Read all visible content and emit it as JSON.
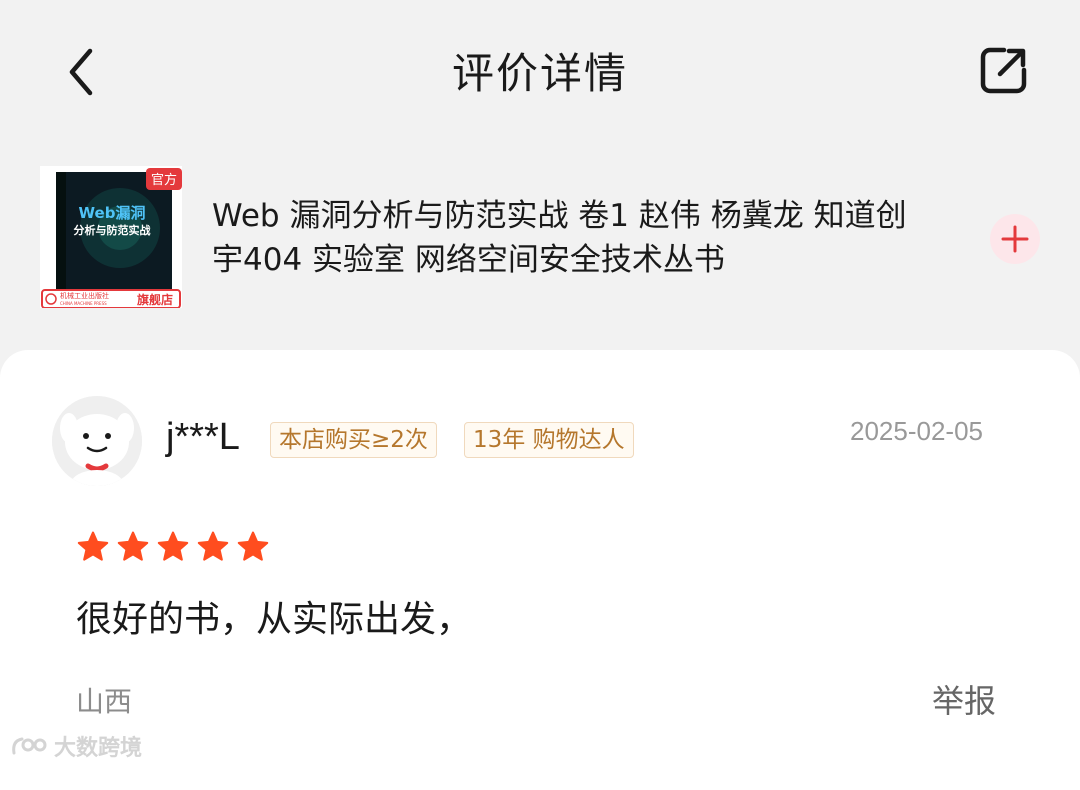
{
  "header": {
    "title": "评价详情",
    "back_icon": "chevron-left-icon",
    "share_icon": "share-icon"
  },
  "product": {
    "title": "Web 漏洞分析与防范实战 卷1 赵伟 杨冀龙 知道创宇404 实验室 网络空间安全技术丛书",
    "cover": {
      "tag": "官方",
      "title_line1": "Web漏洞",
      "title_line2": "分析与防范实战",
      "publisher": "机械工业出版社",
      "publisher_en": "CHINA MACHINE PRESS",
      "store_badge": "旗舰店"
    },
    "add_icon": "plus-icon"
  },
  "review": {
    "username": "j***L",
    "badges": [
      "本店购买≥2次",
      "13年 购物达人"
    ],
    "date": "2025-02-05",
    "rating": 5,
    "text": "很好的书，从实际出发，",
    "location": "山西",
    "report_label": "举报"
  },
  "watermark": {
    "text": "大数跨境"
  },
  "colors": {
    "star": "#ff4d1f",
    "badge_text": "#b5772d",
    "accent": "#e4393c"
  }
}
